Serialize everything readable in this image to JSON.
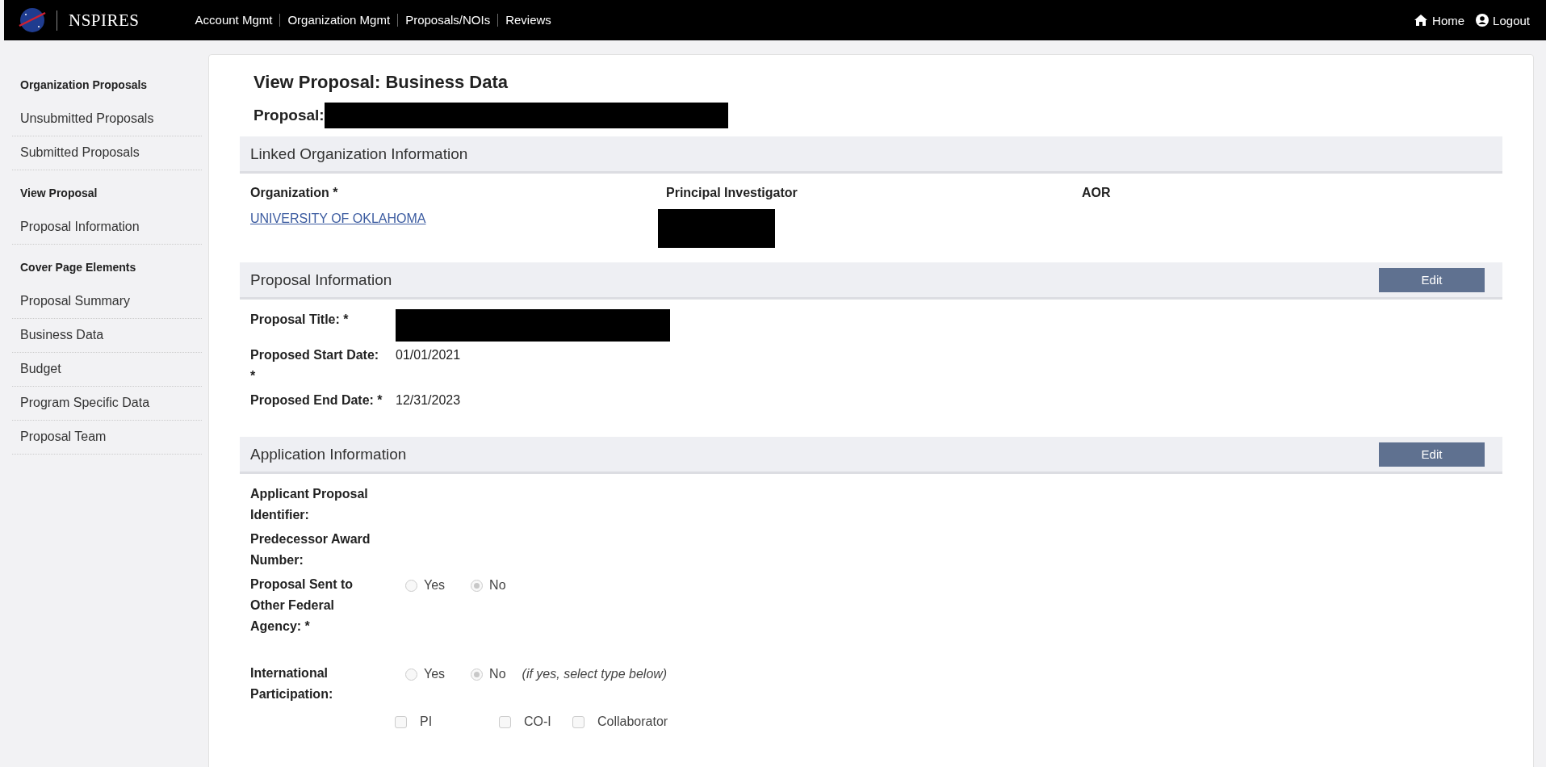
{
  "header": {
    "logo_text": "NSPIRES",
    "nav": [
      "Account Mgmt",
      "Organization Mgmt",
      "Proposals/NOIs",
      "Reviews"
    ],
    "home": "Home",
    "logout": "Logout"
  },
  "sidebar": {
    "groups": [
      {
        "heading": "Organization Proposals",
        "items": [
          "Unsubmitted Proposals",
          "Submitted Proposals"
        ]
      },
      {
        "heading": "View Proposal",
        "items": [
          "Proposal Information"
        ]
      },
      {
        "heading": "Cover Page Elements",
        "items": [
          "Proposal Summary",
          "Business Data",
          "Budget",
          "Program Specific Data",
          "Proposal Team"
        ]
      }
    ]
  },
  "page": {
    "title": "View Proposal: Business Data",
    "proposal_label": "Proposal:"
  },
  "linked_org": {
    "title": "Linked Organization Information",
    "columns": [
      {
        "label": "Organization *",
        "kind": "link",
        "value": "UNIVERSITY OF OKLAHOMA"
      },
      {
        "label": "Principal Investigator",
        "kind": "redacted"
      },
      {
        "label": "AOR",
        "kind": "empty"
      }
    ]
  },
  "proposal_info": {
    "title": "Proposal Information",
    "edit": "Edit",
    "fields": [
      {
        "label": "Proposal Title: *",
        "kind": "redacted"
      },
      {
        "label": "Proposed Start Date: *",
        "kind": "text",
        "value": "01/01/2021"
      },
      {
        "label": "Proposed End Date: *",
        "kind": "text",
        "value": "12/31/2023"
      }
    ]
  },
  "application_info": {
    "title": "Application Information",
    "edit": "Edit",
    "fields": [
      {
        "label": "Applicant Proposal Identifier:",
        "kind": "empty"
      },
      {
        "label": "Predecessor Award Number:",
        "kind": "empty"
      },
      {
        "label": "Proposal Sent to Other Federal Agency: *",
        "kind": "radio",
        "options": [
          {
            "label": "Yes",
            "selected": false
          },
          {
            "label": "No",
            "selected": true
          }
        ]
      },
      {
        "label": "International Participation:",
        "kind": "radio",
        "note": "(if yes, select type below)",
        "options": [
          {
            "label": "Yes",
            "selected": false
          },
          {
            "label": "No",
            "selected": true
          }
        ],
        "checkboxes": [
          {
            "label": "PI",
            "checked": false
          },
          {
            "label": "CO-I",
            "checked": false
          },
          {
            "label": "Collaborator",
            "checked": false
          }
        ]
      }
    ]
  }
}
